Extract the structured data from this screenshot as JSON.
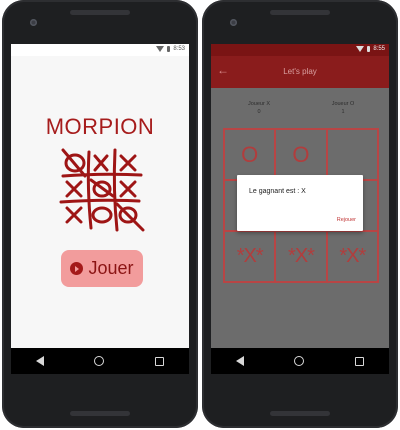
{
  "status_time_left": "8:53",
  "status_time_right": "8:55",
  "home": {
    "title": "MORPION",
    "play_button": "Jouer"
  },
  "game": {
    "appbar_title": "Let's play",
    "back_icon": "arrow-left-icon",
    "player_x": {
      "label": "Joueur X",
      "score": "0"
    },
    "player_o": {
      "label": "Joueur O",
      "score": "1"
    },
    "board": [
      "O",
      "O",
      "",
      "",
      "",
      "",
      "*X*",
      "*X*",
      "*X*"
    ],
    "dialog": {
      "message": "Le gagnant est : X",
      "replay": "Rejouer"
    }
  },
  "colors": {
    "accent": "#8a1c1c",
    "title_red": "#a61c1c",
    "button_pink": "#f29c9c",
    "board_line": "#b84545"
  }
}
